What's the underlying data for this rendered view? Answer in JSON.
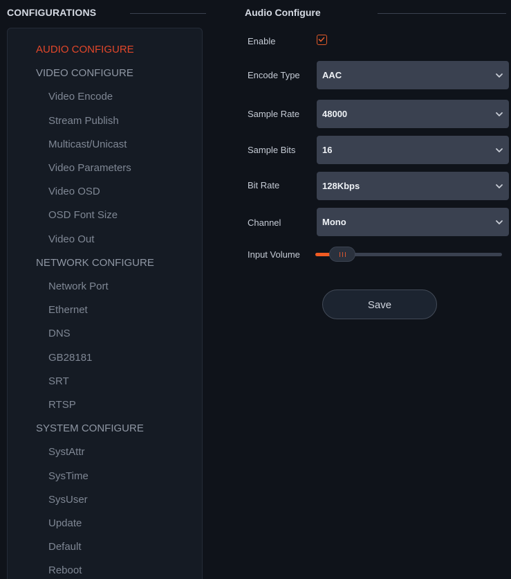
{
  "left_panel": {
    "title": "CONFIGURATIONS",
    "items": [
      {
        "label": "AUDIO CONFIGURE",
        "level": "section",
        "active": true
      },
      {
        "label": "VIDEO CONFIGURE",
        "level": "section",
        "active": false
      },
      {
        "label": "Video Encode",
        "level": "sub",
        "active": false
      },
      {
        "label": "Stream Publish",
        "level": "sub",
        "active": false
      },
      {
        "label": "Multicast/Unicast",
        "level": "sub",
        "active": false
      },
      {
        "label": "Video Parameters",
        "level": "sub",
        "active": false
      },
      {
        "label": "Video OSD",
        "level": "sub",
        "active": false
      },
      {
        "label": "OSD Font Size",
        "level": "sub",
        "active": false
      },
      {
        "label": "Video Out",
        "level": "sub",
        "active": false
      },
      {
        "label": "NETWORK CONFIGURE",
        "level": "section",
        "active": false
      },
      {
        "label": "Network Port",
        "level": "sub",
        "active": false
      },
      {
        "label": "Ethernet",
        "level": "sub",
        "active": false
      },
      {
        "label": "DNS",
        "level": "sub",
        "active": false
      },
      {
        "label": "GB28181",
        "level": "sub",
        "active": false
      },
      {
        "label": "SRT",
        "level": "sub",
        "active": false
      },
      {
        "label": "RTSP",
        "level": "sub",
        "active": false
      },
      {
        "label": "SYSTEM CONFIGURE",
        "level": "section",
        "active": false
      },
      {
        "label": "SystAttr",
        "level": "sub",
        "active": false
      },
      {
        "label": "SysTime",
        "level": "sub",
        "active": false
      },
      {
        "label": "SysUser",
        "level": "sub",
        "active": false
      },
      {
        "label": "Update",
        "level": "sub",
        "active": false
      },
      {
        "label": "Default",
        "level": "sub",
        "active": false
      },
      {
        "label": "Reboot",
        "level": "sub",
        "active": false
      }
    ]
  },
  "form": {
    "title": "Audio Configure",
    "enable": {
      "label": "Enable",
      "checked": true
    },
    "encode_type": {
      "label": "Encode Type",
      "value": "AAC"
    },
    "sample_rate": {
      "label": "Sample Rate",
      "value": "48000"
    },
    "sample_bits": {
      "label": "Sample Bits",
      "value": "16"
    },
    "bit_rate": {
      "label": "Bit Rate",
      "value": "128Kbps"
    },
    "channel": {
      "label": "Channel",
      "value": "Mono"
    },
    "input_volume": {
      "label": "Input Volume",
      "level_fraction": 0.08
    },
    "save_label": "Save"
  },
  "colors": {
    "accent": "#e2472a",
    "background": "#0f131a",
    "panel": "#151b24",
    "select_bg": "#3a4150",
    "slider_fill": "#f05b22"
  },
  "icons": {
    "checkbox": "check-icon",
    "select": "chevron-down-icon",
    "slider": "grip-icon"
  }
}
